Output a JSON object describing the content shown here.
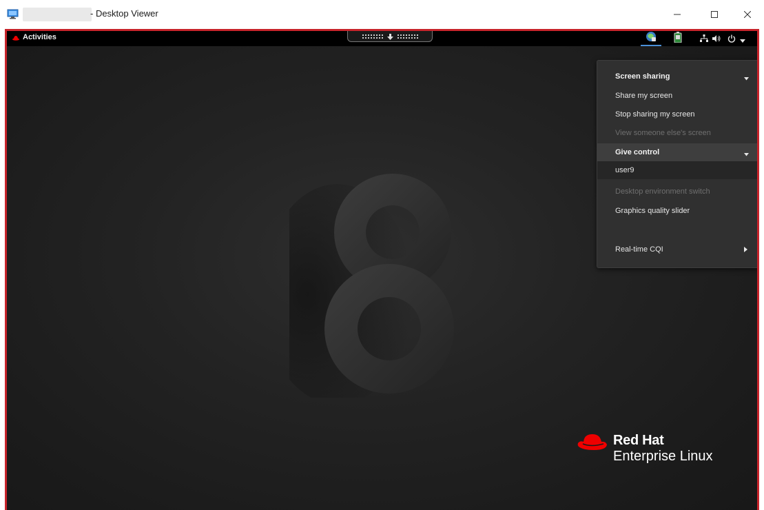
{
  "window": {
    "title": "- Desktop Viewer",
    "controls": {
      "minimize": "–",
      "maximize": "☐",
      "close": "✕"
    }
  },
  "topbar": {
    "activities_label": "Activities",
    "tray_icons": [
      "screen-share-icon",
      "battery-icon",
      "network-icon",
      "volume-icon",
      "power-icon",
      "chevron-down-icon"
    ]
  },
  "menu": {
    "screen_sharing": {
      "header": "Screen sharing",
      "items": [
        {
          "label": "Share my screen",
          "enabled": true
        },
        {
          "label": "Stop sharing my screen",
          "enabled": true
        },
        {
          "label": "View someone else's screen",
          "enabled": false
        }
      ]
    },
    "give_control": {
      "header": "Give control",
      "items": [
        {
          "label": "user9",
          "enabled": true
        }
      ]
    },
    "desktop_switch": {
      "label": "Desktop environment switch",
      "enabled": false
    },
    "graphics_slider": {
      "label": "Graphics quality slider"
    },
    "realtime_cqi": {
      "label": "Real-time CQI"
    }
  },
  "brand": {
    "line1": "Red Hat",
    "line2": "Enterprise Linux"
  },
  "colors": {
    "accent_red": "#c7242b",
    "brand_red": "#ee0000",
    "menu_bg": "#303030",
    "topbar_bg": "#000000"
  }
}
